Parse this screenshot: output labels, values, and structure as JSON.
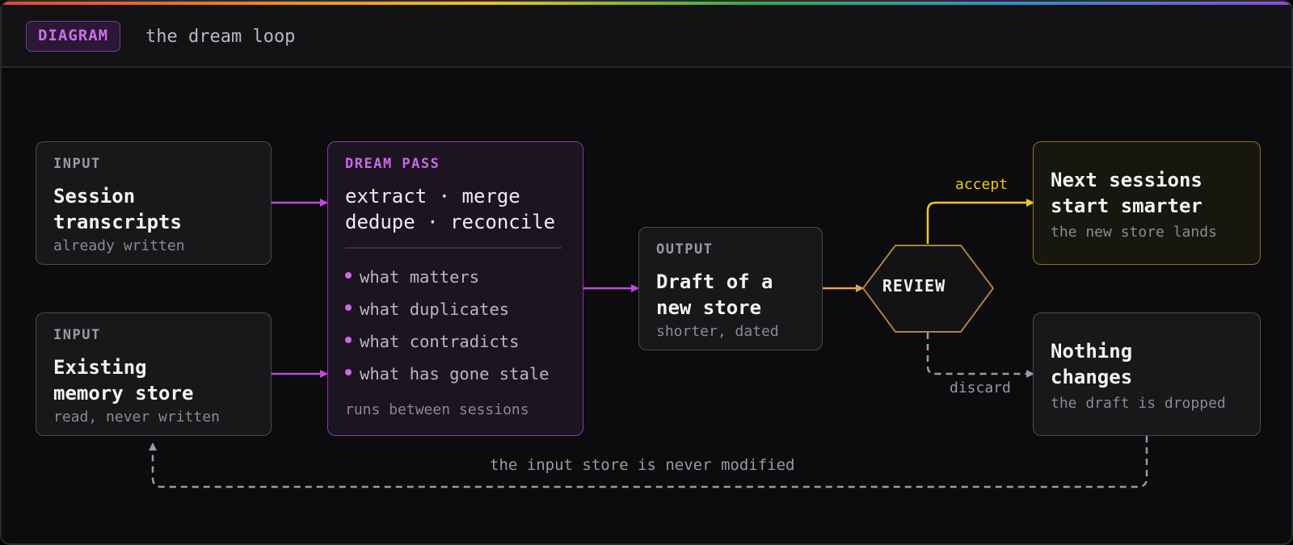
{
  "header": {
    "badge": "DIAGRAM",
    "title": "the dream loop"
  },
  "nodes": {
    "input_transcripts": {
      "kicker": "INPUT",
      "title": "Session\ntranscripts",
      "sub": "already written"
    },
    "input_store": {
      "kicker": "INPUT",
      "title": "Existing\nmemory store",
      "sub": "read, never written"
    },
    "dream_pass": {
      "kicker": "DREAM PASS",
      "title": "extract · merge\ndedupe · reconcile",
      "items": [
        "what matters",
        "what duplicates",
        "what contradicts",
        "what has gone stale"
      ],
      "footer": "runs between sessions"
    },
    "output": {
      "kicker": "OUTPUT",
      "title": "Draft of a\nnew store",
      "sub": "shorter, dated"
    },
    "review": {
      "label": "REVIEW"
    },
    "accept_result": {
      "title": "Next sessions\nstart smarter",
      "sub": "the new store lands"
    },
    "discard_result": {
      "title": "Nothing\nchanges",
      "sub": "the draft is dropped"
    }
  },
  "edges": {
    "accept": "accept",
    "discard": "discard",
    "loop_note": "the input store is never modified"
  },
  "colors": {
    "purple": "#c04ad8",
    "orange": "#e0a050",
    "yellow": "#f0c81e",
    "gray": "#9a9aa2",
    "review_border": "#a8804a"
  }
}
